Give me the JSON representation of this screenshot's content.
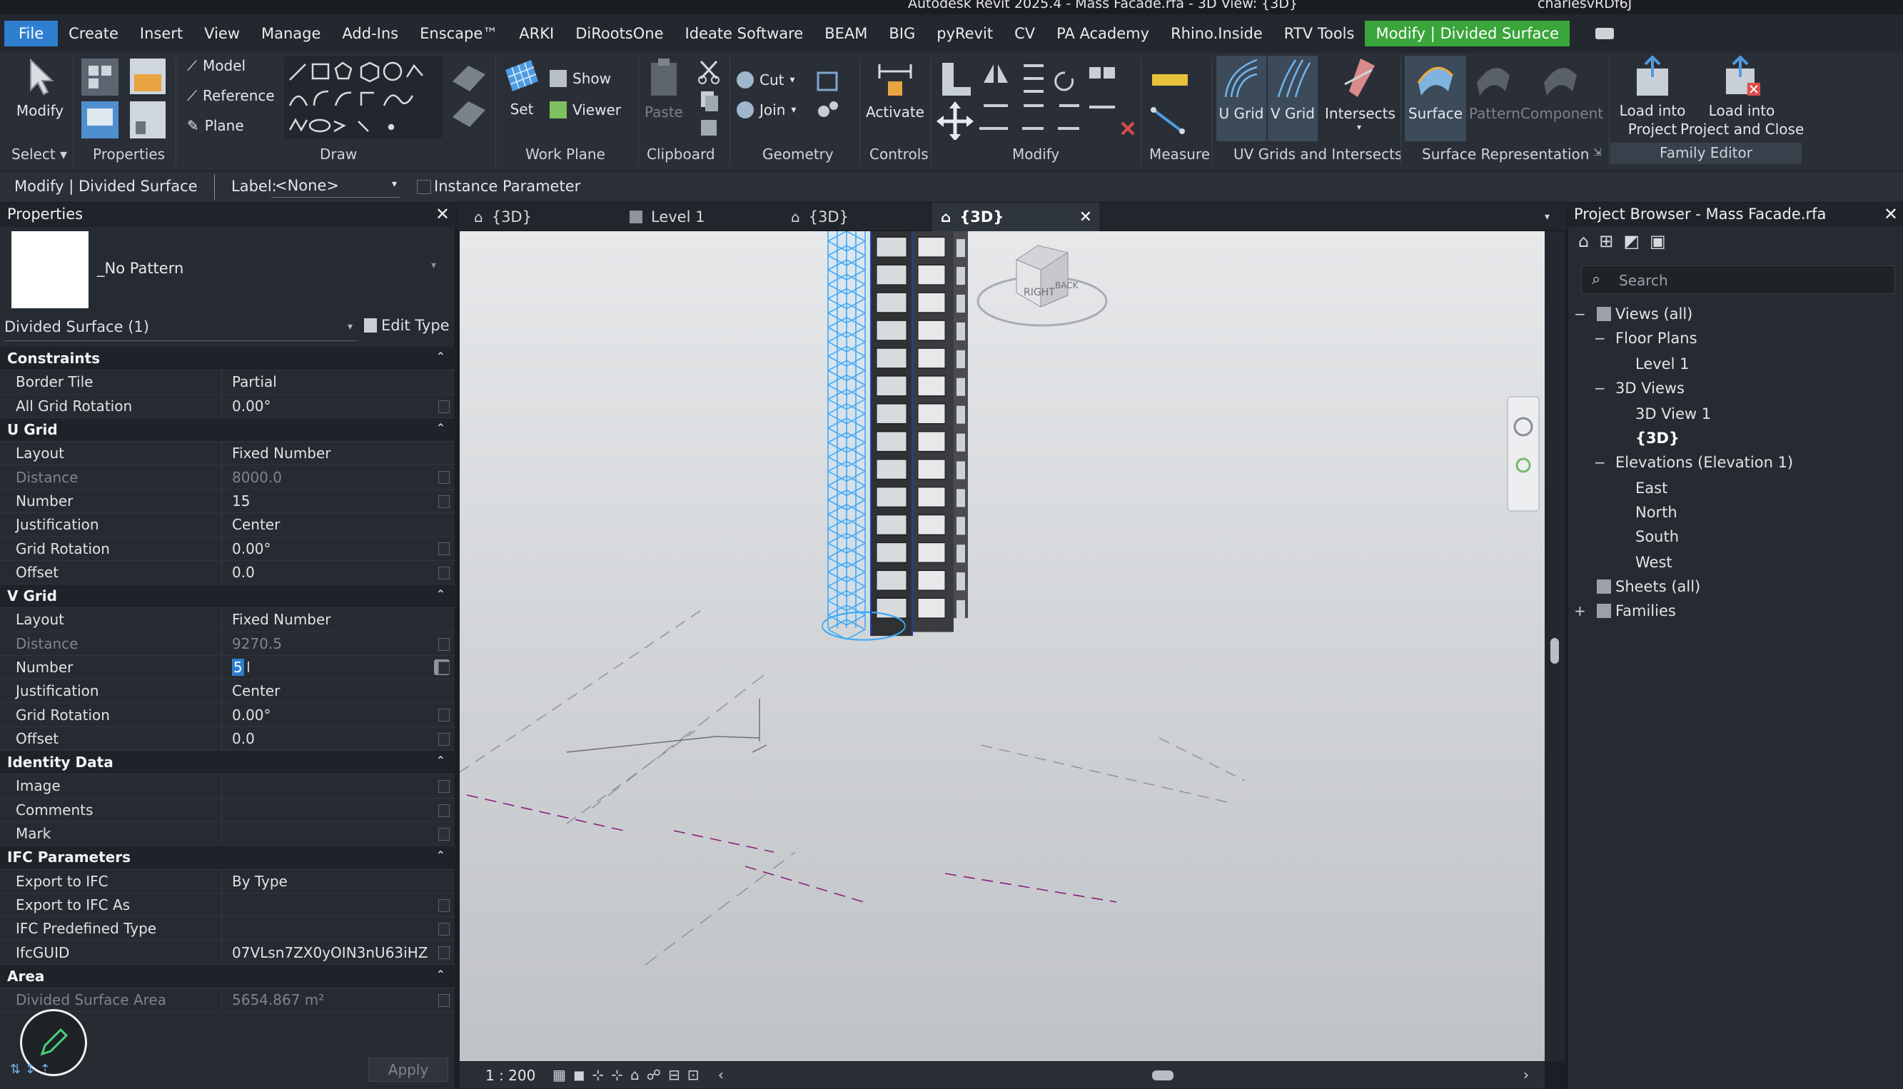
{
  "title_bar": {
    "title": "Autodesk Revit 2025.4 - Mass Facade.rfa - 3D View: {3D}",
    "user": "charlesvRDf6J"
  },
  "menu": {
    "tabs": [
      "File",
      "Create",
      "Insert",
      "View",
      "Manage",
      "Add-Ins",
      "Enscape™",
      "ARKI",
      "DiRootsOne",
      "Ideate Software",
      "BEAM",
      "BIG",
      "pyRevit",
      "CV",
      "PA Academy",
      "Rhino.Inside",
      "RTV Tools",
      "Modify | Divided Surface"
    ]
  },
  "ribbon": {
    "modify": "Modify",
    "select": "Select",
    "properties": "Properties",
    "model": "Model",
    "reference": "Reference",
    "plane": "Plane",
    "draw": "Draw",
    "set": "Set",
    "show": "Show",
    "viewer": "Viewer",
    "work_plane": "Work Plane",
    "paste": "Paste",
    "clipboard": "Clipboard",
    "cut": "Cut",
    "join": "Join",
    "geometry": "Geometry",
    "activate": "Activate",
    "controls": "Controls",
    "modify_panel": "Modify",
    "measure": "Measure",
    "u_grid": "U Grid",
    "v_grid": "V Grid",
    "intersects": "Intersects",
    "uv_panel": "UV Grids and Intersects",
    "surface": "Surface",
    "pattern": "Pattern",
    "component": "Component",
    "surface_panel": "Surface Representation",
    "load_into_project_1": "Load into",
    "load_into_project_2": "Project",
    "load_close_1": "Load into",
    "load_close_2": "Project and Close",
    "family_editor": "Family Editor"
  },
  "options_bar": {
    "context": "Modify | Divided Surface",
    "label_caption": "Label:",
    "label_value": "<None>",
    "instance_param": "Instance Parameter"
  },
  "properties": {
    "title": "Properties",
    "type_name": "_No Pattern",
    "selector": "Divided Surface (1)",
    "edit_type": "Edit Type",
    "groups": {
      "constraints": "Constraints",
      "u_grid": "U Grid",
      "v_grid": "V Grid",
      "identity": "Identity Data",
      "ifc": "IFC Parameters",
      "area": "Area"
    },
    "rows": {
      "border_tile": [
        "Border Tile",
        "Partial"
      ],
      "all_grid_rotation": [
        "All Grid Rotation",
        "0.00°"
      ],
      "u_layout": [
        "Layout",
        "Fixed Number"
      ],
      "u_distance": [
        "Distance",
        "8000.0"
      ],
      "u_number": [
        "Number",
        "15"
      ],
      "u_justification": [
        "Justification",
        "Center"
      ],
      "u_grid_rotation": [
        "Grid Rotation",
        "0.00°"
      ],
      "u_offset": [
        "Offset",
        "0.0"
      ],
      "v_layout": [
        "Layout",
        "Fixed Number"
      ],
      "v_distance": [
        "Distance",
        "9270.5"
      ],
      "v_number": [
        "Number",
        "5"
      ],
      "v_justification": [
        "Justification",
        "Center"
      ],
      "v_grid_rotation": [
        "Grid Rotation",
        "0.00°"
      ],
      "v_offset": [
        "Offset",
        "0.0"
      ],
      "image": [
        "Image",
        ""
      ],
      "comments": [
        "Comments",
        ""
      ],
      "mark": [
        "Mark",
        ""
      ],
      "export_ifc": [
        "Export to IFC",
        "By Type"
      ],
      "export_ifc_as": [
        "Export to IFC As",
        ""
      ],
      "ifc_predefined": [
        "IFC Predefined Type",
        ""
      ],
      "ifc_guid": [
        "IfcGUID",
        "07VLsn7ZX0yOIN3nU63iHZ"
      ],
      "divided_area": [
        "Divided Surface Area",
        "5654.867 m²"
      ]
    },
    "apply": "Apply"
  },
  "view_tabs": [
    "{3D}",
    "Level 1",
    "{3D}",
    "{3D}"
  ],
  "viewport": {
    "scale": "1 : 200",
    "viewcube_faces": [
      "RIGHT",
      "BACK"
    ]
  },
  "project_browser": {
    "title": "Project Browser - Mass Facade.rfa",
    "search_placeholder": "Search",
    "tree": {
      "views_all": "Views (all)",
      "floor_plans": "Floor Plans",
      "level1": "Level 1",
      "views_3d": "3D Views",
      "view3d1": "3D View 1",
      "view3d": "{3D}",
      "elevations": "Elevations (Elevation 1)",
      "east": "East",
      "north": "North",
      "south": "South",
      "west": "West",
      "sheets": "Sheets (all)",
      "families": "Families"
    }
  },
  "colors": {
    "accent_blue": "#2e7fd0",
    "context_green": "#3aa53a",
    "grid_blue": "#3fa9f5"
  }
}
